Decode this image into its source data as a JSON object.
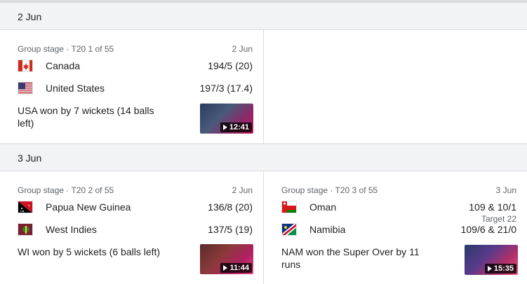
{
  "days": [
    {
      "date": "2 Jun",
      "matches": [
        {
          "stage": "Group stage · T20 1 of 55",
          "date": "2 Jun",
          "teams": [
            {
              "name": "Canada",
              "score": "194/5 (20)",
              "flag": "canada"
            },
            {
              "name": "United States",
              "score": "197/3 (17.4)",
              "flag": "usa"
            }
          ],
          "result": "USA won by 7 wickets (14 balls left)",
          "video_duration": "12:41"
        }
      ]
    },
    {
      "date": "3 Jun",
      "matches": [
        {
          "stage": "Group stage · T20 2 of 55",
          "date": "2 Jun",
          "teams": [
            {
              "name": "Papua New Guinea",
              "score": "136/8 (20)",
              "flag": "png"
            },
            {
              "name": "West Indies",
              "score": "137/5 (19)",
              "flag": "wi"
            }
          ],
          "result": "WI won by 5 wickets (6 balls left)",
          "video_duration": "11:44"
        },
        {
          "stage": "Group stage · T20 3 of 55",
          "date": "3 Jun",
          "teams": [
            {
              "name": "Oman",
              "score": "109 & 10/1",
              "target": "Target 22",
              "flag": "oman"
            },
            {
              "name": "Namibia",
              "score": "109/6 & 21/0",
              "flag": "namibia"
            }
          ],
          "result": "NAM won the Super Over by 11 runs",
          "video_duration": "15:35"
        }
      ]
    }
  ]
}
